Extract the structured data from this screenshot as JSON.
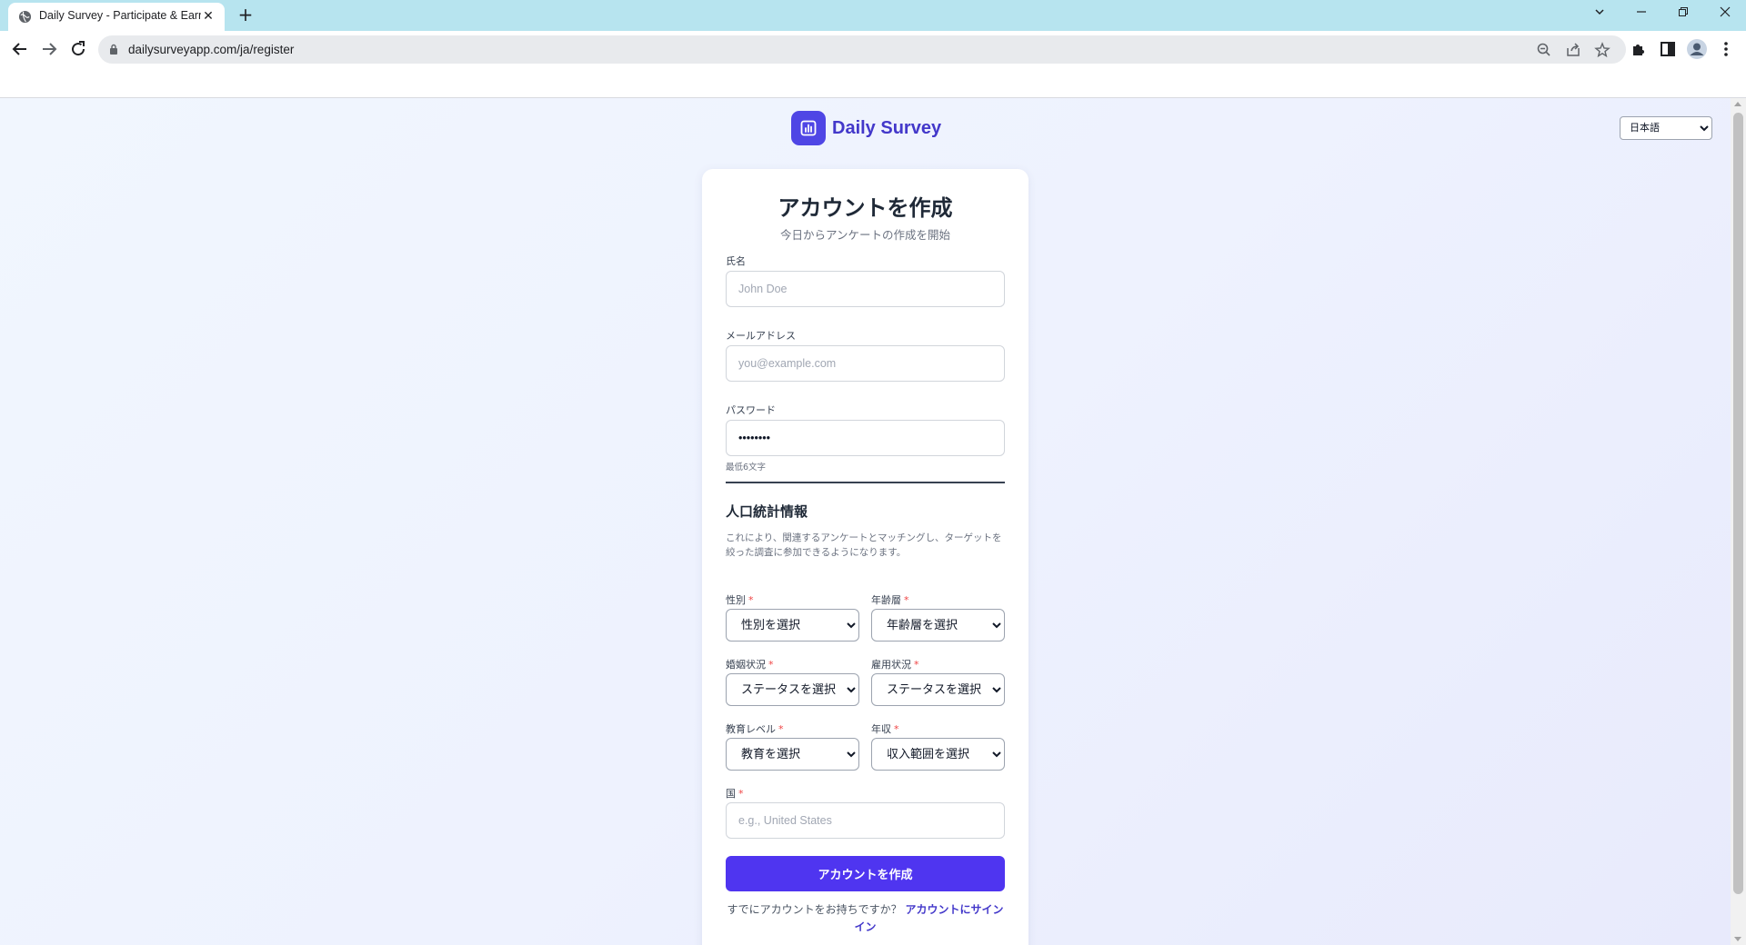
{
  "browser": {
    "tab_title": "Daily Survey - Participate & Earn",
    "new_tab_symbol": "+",
    "url": "dailysurveyapp.com/ja/register",
    "icons": [
      "back-icon",
      "forward-icon",
      "reload-icon",
      "lock-icon",
      "zoom-icon",
      "share-icon",
      "star-icon",
      "extensions-icon",
      "side-panel-icon",
      "profile-icon",
      "menu-icon",
      "tab-search-icon",
      "minimize-icon",
      "restore-icon",
      "close-icon"
    ]
  },
  "page": {
    "brand_name": "Daily Survey",
    "language_select": {
      "value": "日本語"
    },
    "form": {
      "title": "アカウントを作成",
      "subtitle": "今日からアンケートの作成を開始",
      "name": {
        "label": "氏名",
        "placeholder": "John Doe"
      },
      "email": {
        "label": "メールアドレス",
        "placeholder": "you@example.com"
      },
      "password": {
        "label": "パスワード",
        "value": "••••••••",
        "hint": "最低6文字"
      },
      "demographics": {
        "title": "人口統計情報",
        "description": "これにより、関連するアンケートとマッチングし、ターゲットを絞った調査に参加できるようになります。",
        "required_mark": "*",
        "gender": {
          "label": "性別",
          "value": "性別を選択"
        },
        "age": {
          "label": "年齢層",
          "value": "年齢層を選択"
        },
        "marital": {
          "label": "婚姻状況",
          "value": "ステータスを選択"
        },
        "employment": {
          "label": "雇用状況",
          "value": "ステータスを選択"
        },
        "education": {
          "label": "教育レベル",
          "value": "教育を選択"
        },
        "income": {
          "label": "年収",
          "value": "収入範囲を選択"
        },
        "country": {
          "label": "国",
          "placeholder": "e.g., United States"
        }
      },
      "submit_label": "アカウントを作成",
      "signin_prompt": "すでにアカウントをお持ちですか？",
      "signin_link": "アカウントにサインイン"
    }
  },
  "colors": {
    "brand": "#4f46e5",
    "brand_text": "#4338ca",
    "button": "#4f35f0",
    "required": "#ef4444",
    "tabbar": "#b7e4ef"
  }
}
